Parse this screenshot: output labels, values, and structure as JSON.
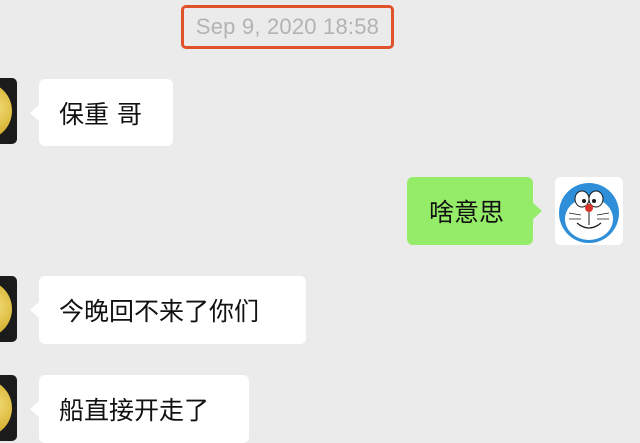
{
  "timestamp": "Sep 9, 2020 18:58",
  "messages": [
    {
      "side": "left",
      "text": "保重 哥",
      "avatar": "gold-coin-avatar"
    },
    {
      "side": "right",
      "text": "啥意思",
      "avatar": "doraemon-avatar"
    },
    {
      "side": "left",
      "text": "今晚回不来了你们",
      "avatar": "gold-coin-avatar"
    },
    {
      "side": "left",
      "text": "船直接开走了",
      "avatar": "gold-coin-avatar"
    }
  ],
  "colors": {
    "background": "#ebebeb",
    "incoming_bubble": "#ffffff",
    "outgoing_bubble": "#95ec69",
    "highlight_border": "#e0532a",
    "timestamp_text": "#b3b3b3"
  }
}
